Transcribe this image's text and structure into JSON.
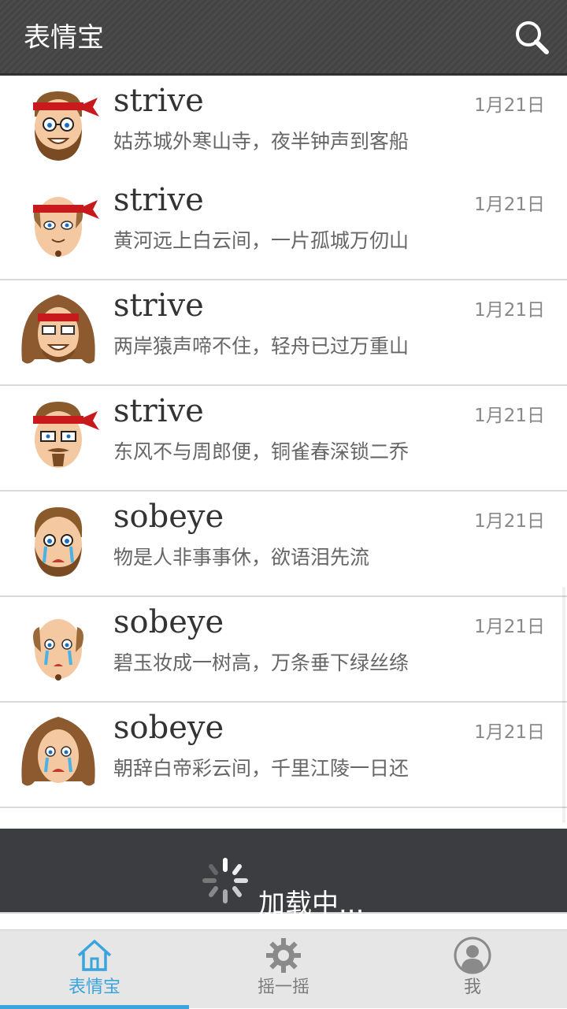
{
  "app": {
    "title": "表情宝"
  },
  "header": {
    "search_icon": "search-icon"
  },
  "messages": [
    {
      "name": "strive",
      "text": "姑苏城外寒山寺，夜半钟声到客船",
      "date": "1月21日",
      "avatar": "headband-glasses-beard"
    },
    {
      "name": "strive",
      "text": "黄河远上白云间，一片孤城万仞山",
      "date": "1月21日",
      "avatar": "headband-bald"
    },
    {
      "name": "strive",
      "text": "两岸猿声啼不住，轻舟已过万重山",
      "date": "1月21日",
      "avatar": "headband-curly"
    },
    {
      "name": "strive",
      "text": "东风不与周郎便，铜雀春深锁二乔",
      "date": "1月21日",
      "avatar": "headband-glasses-goatee"
    },
    {
      "name": "sobeye",
      "text": "物是人非事事休，欲语泪先流",
      "date": "1月21日",
      "avatar": "crying-beard"
    },
    {
      "name": "sobeye",
      "text": "碧玉妆成一树高，万条垂下绿丝绦",
      "date": "1月21日",
      "avatar": "crying-bald"
    },
    {
      "name": "sobeye",
      "text": "朝辞白帝彩云间，千里江陵一日还",
      "date": "1月21日",
      "avatar": "crying-curly"
    }
  ],
  "loading": {
    "text": "加载中..."
  },
  "tabs": [
    {
      "label": "表情宝",
      "icon": "home-icon",
      "active": true
    },
    {
      "label": "摇一摇",
      "icon": "gear-icon",
      "active": false
    },
    {
      "label": "我",
      "icon": "person-icon",
      "active": false
    }
  ],
  "colors": {
    "accent": "#3aa4dd",
    "header": "#474747",
    "loading_bg": "#3b3d40"
  }
}
